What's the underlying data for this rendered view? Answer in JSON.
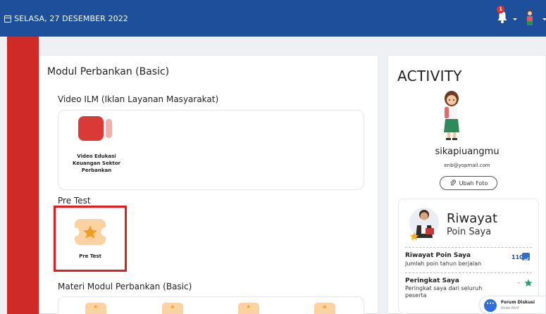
{
  "header": {
    "date": "SELASA, 27 DESEMBER 2022",
    "notification_count": "1"
  },
  "module": {
    "title": "Modul Perbankan (Basic)",
    "sections": {
      "video": {
        "title": "Video ILM (Iklan Layanan Masyarakat)",
        "item_label": "Video Edukasi Keuangan Sektor Perbankan"
      },
      "pretest": {
        "title": "Pre Test",
        "item_label": "Pre Test"
      },
      "materi": {
        "title": "Materi Modul Perbankan (Basic)"
      }
    }
  },
  "activity": {
    "title": "ACTIVITY",
    "username": "sikapiuangmu",
    "email": "enb@yopmail.com",
    "change_photo_label": "Ubah Foto",
    "points": {
      "title": "Riwayat",
      "subtitle": "Poin Saya",
      "history_label": "Riwayat Poin Saya",
      "history_desc": "Jumlah poin tahun berjalan",
      "history_value": "110",
      "rank_label": "Peringkat Saya",
      "rank_desc": "Peringkat saya dari seluruh peserta",
      "rank_value": "-"
    }
  },
  "forum": {
    "title": "Forum Diskusi",
    "subtitle": "Anda Aktif"
  },
  "colors": {
    "header": "#1e4f9a",
    "sidebar": "#cf2a27",
    "highlight": "#e01e1e"
  }
}
